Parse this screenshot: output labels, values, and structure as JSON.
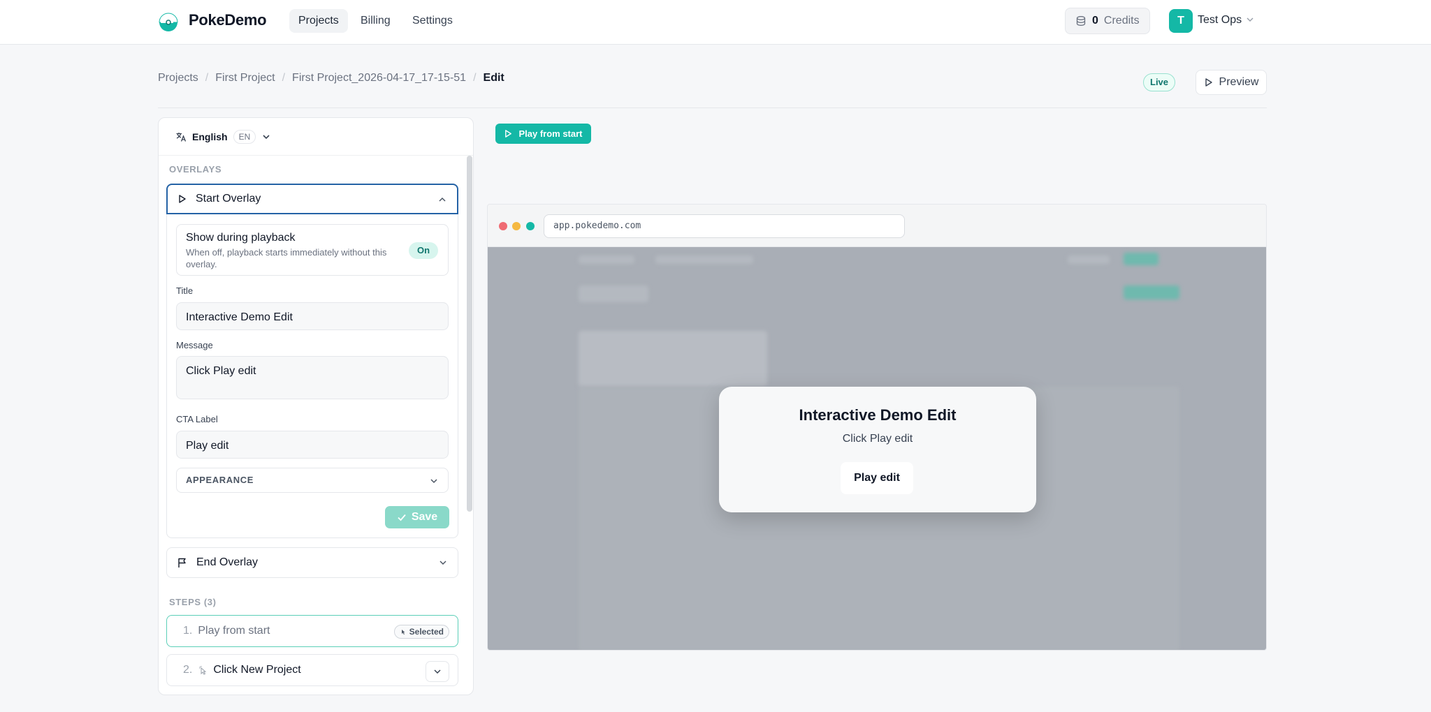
{
  "app": {
    "brand": "PokeDemo",
    "nav": [
      "Projects",
      "Billing",
      "Settings"
    ],
    "credits_count": "0",
    "credits_label": "Credits",
    "user_initial": "T",
    "user_name": "Test Ops"
  },
  "breadcrumb": [
    "Projects",
    "First Project",
    "First Project_2026-04-17_17-15-51",
    "Edit"
  ],
  "status_badge": "Live",
  "preview_label": "Preview",
  "language": {
    "name": "English",
    "code": "EN"
  },
  "overlays": {
    "section_label": "OVERLAYS",
    "start_title": "Start Overlay",
    "show_title": "Show during playback",
    "show_desc": "When off, playback starts immediately without this overlay.",
    "show_state": "On",
    "title_label": "Title",
    "title_value": "Interactive Demo Edit",
    "message_label": "Message",
    "message_value": "Click Play edit",
    "cta_label": "CTA Label",
    "cta_value": "Play edit",
    "appearance_label": "APPEARANCE",
    "save_label": "Save",
    "end_title": "End Overlay"
  },
  "steps": {
    "section_label": "STEPS (3)",
    "items": [
      {
        "num": "1.",
        "title": "Play from start",
        "badge": "Selected"
      },
      {
        "num": "2.",
        "title": "Click New Project"
      }
    ]
  },
  "play_from_start": "Play from start",
  "browser": {
    "url": "app.pokedemo.com"
  },
  "modal": {
    "title": "Interactive Demo Edit",
    "message": "Click Play edit",
    "cta": "Play edit"
  },
  "colors": {
    "accent": "#14b8a6",
    "focus": "#2563a6",
    "save_disabled": "#8ad9c9"
  }
}
